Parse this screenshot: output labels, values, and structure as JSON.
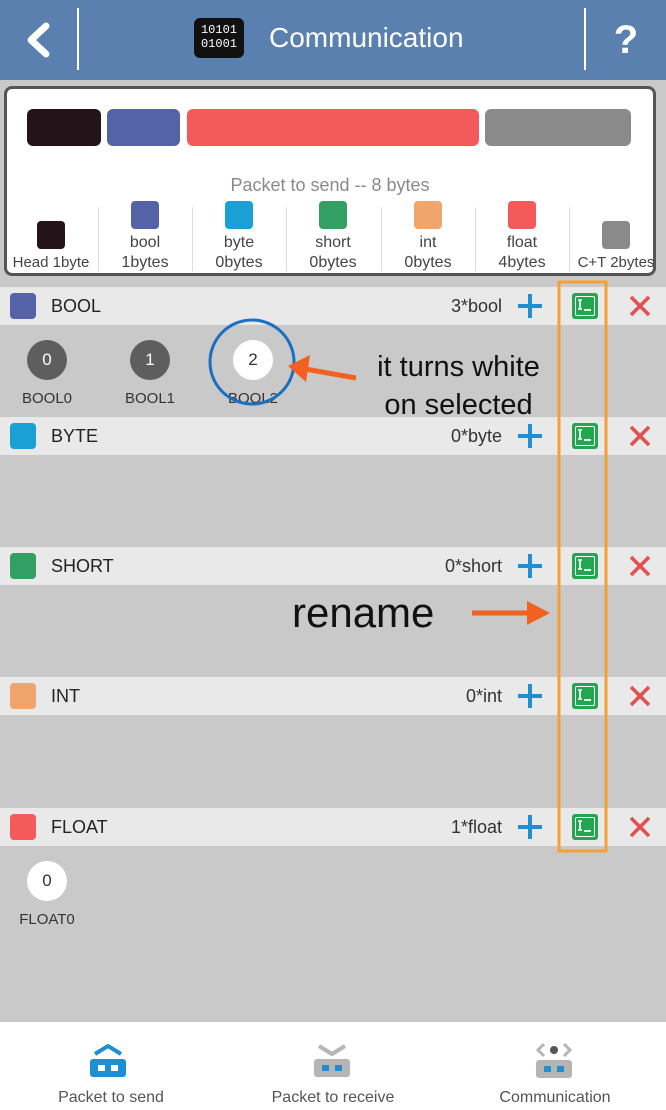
{
  "header": {
    "title": "Communication",
    "logo_text": "10101\n01001",
    "help_label": "?"
  },
  "summary": {
    "title": "Packet to send -- 8 bytes",
    "legend": [
      {
        "label": "Head 1byte",
        "color": "#241419"
      },
      {
        "label": "bool\n1bytes",
        "color": "#5462a8"
      },
      {
        "label": "byte\n0bytes",
        "color": "#1aa0d4"
      },
      {
        "label": "short\n0bytes",
        "color": "#31a062"
      },
      {
        "label": "int\n0bytes",
        "color": "#f0a56c"
      },
      {
        "label": "float\n4bytes",
        "color": "#f55a5a"
      },
      {
        "label": "C+T 2bytes",
        "color": "#8a8a8a"
      }
    ]
  },
  "sections": [
    {
      "name": "BOOL",
      "count": "3*bool",
      "color": "#5462a8",
      "vars": [
        {
          "value": "0",
          "label": "BOOL0"
        },
        {
          "value": "1",
          "label": "BOOL1"
        },
        {
          "value": "2",
          "label": "BOOL2"
        }
      ]
    },
    {
      "name": "BYTE",
      "count": "0*byte",
      "color": "#1aa0d4",
      "vars": []
    },
    {
      "name": "SHORT",
      "count": "0*short",
      "color": "#31a062",
      "vars": []
    },
    {
      "name": "INT",
      "count": "0*int",
      "color": "#f0a56c",
      "vars": []
    },
    {
      "name": "FLOAT",
      "count": "1*float",
      "color": "#f55a5a",
      "vars": [
        {
          "value": "0",
          "label": "FLOAT0"
        }
      ]
    }
  ],
  "annotations": {
    "selected_note": "it turns white\non selected",
    "rename_note": "rename"
  },
  "tabs": [
    {
      "label": "Packet to send",
      "icon": "packet-send-icon"
    },
    {
      "label": "Packet to receive",
      "icon": "packet-receive-icon"
    },
    {
      "label": "Communication",
      "icon": "communication-icon"
    }
  ],
  "colors": {
    "header": "#5a80b0",
    "accent": "#1e90d2",
    "delete": "#e05050",
    "rename": "#22a650",
    "highlight": "#f5a035",
    "arrow": "#f26122"
  }
}
